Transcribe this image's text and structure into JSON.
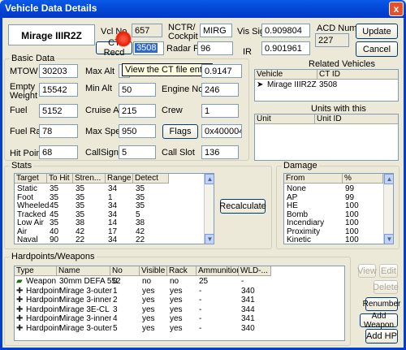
{
  "window": {
    "title": "Vehicle Data Details",
    "close_glyph": "x"
  },
  "name_box": "Mirage IIIR2Z",
  "vcl_no": {
    "label": "Vcl No",
    "value": "657"
  },
  "nctr": {
    "label_line1": "NCTR/",
    "label_line2": "Cockpit",
    "value": "MIRG"
  },
  "vis_sig": {
    "label": "Vis Sig",
    "value": "0.909804"
  },
  "acd_number": {
    "label": "ACD Number",
    "value": "227"
  },
  "ct_recd": {
    "label": "CT Recd",
    "value": "3508"
  },
  "radar_ptr": {
    "label": "Radar Ptr",
    "value": "96"
  },
  "ir": {
    "label": "IR",
    "value": "0.901961"
  },
  "buttons": {
    "update": "Update",
    "cancel": "Cancel",
    "recalculate": "Recalculate",
    "flags": "Flags",
    "view": "View",
    "edit": "Edit",
    "delete": "Delete",
    "renumber": "Renumber",
    "add_weapon": "Add Weapon",
    "add_hp": "Add HP"
  },
  "tooltip": "View the CT file entry",
  "basic": {
    "title": "Basic Data",
    "mtow": {
      "label": "MTOW",
      "value": "30203"
    },
    "max_alt": {
      "label": "Max Alt",
      "value": "2"
    },
    "max_alt_right": "0.9147",
    "empty_weight": {
      "label_line1": "Empty",
      "label_line2": "Weight",
      "value": "15542"
    },
    "min_alt": {
      "label": "Min Alt",
      "value": "50"
    },
    "engine_noise": {
      "label": "Engine Noise",
      "value": "246"
    },
    "fuel": {
      "label": "Fuel",
      "value": "5152"
    },
    "cruise_alt": {
      "label": "Cruise Alt",
      "value": "215"
    },
    "crew": {
      "label": "Crew",
      "value": "1"
    },
    "fuel_rate": {
      "label": "Fuel Rate",
      "value": "78"
    },
    "max_speed": {
      "label": "Max Speed",
      "value": "950"
    },
    "flags_value": "0x40000451",
    "hit_points": {
      "label": "Hit Points",
      "value": "68"
    },
    "callsign": {
      "label": "CallSign",
      "value": "5"
    },
    "call_slot": {
      "label": "Call Slot",
      "value": "136"
    }
  },
  "related": {
    "title": "Related Vehicles",
    "columns": [
      "Vehicle",
      "CT ID"
    ],
    "rows": [
      {
        "vehicle": "Mirage IIIR2Z",
        "ct_id": "3508"
      }
    ]
  },
  "units": {
    "title": "Units with this",
    "columns": [
      "Unit",
      "Unit ID"
    ]
  },
  "stats": {
    "title": "Stats",
    "columns": [
      "Target",
      "To Hit",
      "Stren...",
      "Range",
      "Detect"
    ],
    "rows": [
      [
        "Static",
        "35",
        "35",
        "34",
        "35"
      ],
      [
        "Foot",
        "35",
        "35",
        "1",
        "35"
      ],
      [
        "Wheeled",
        "45",
        "35",
        "34",
        "35"
      ],
      [
        "Tracked",
        "45",
        "35",
        "34",
        "5"
      ],
      [
        "Low Air",
        "35",
        "38",
        "14",
        "38"
      ],
      [
        "Air",
        "40",
        "42",
        "17",
        "42"
      ],
      [
        "Naval",
        "90",
        "22",
        "34",
        "22"
      ]
    ]
  },
  "damage": {
    "title": "Damage",
    "columns": [
      "From",
      "%"
    ],
    "rows": [
      [
        "None",
        "99"
      ],
      [
        "AP",
        "99"
      ],
      [
        "HE",
        "100"
      ],
      [
        "Bomb",
        "100"
      ],
      [
        "Incendiary",
        "100"
      ],
      [
        "Proximity",
        "100"
      ],
      [
        "Kinetic",
        "100"
      ]
    ]
  },
  "hardpoints": {
    "title": "Hardpoints/Weapons",
    "columns": [
      "Type",
      "Name",
      "No",
      "Visible",
      "Rack",
      "Ammunition",
      "WLD-..."
    ],
    "rows": [
      {
        "type": "Weapon",
        "name": "30mm DEFA 552",
        "no": "0",
        "visible": "no",
        "rack": "no",
        "ammo": "25",
        "wld": "-"
      },
      {
        "type": "Hardpoint",
        "name": "Mirage 3-outer",
        "no": "1",
        "visible": "yes",
        "rack": "yes",
        "ammo": "-",
        "wld": "340"
      },
      {
        "type": "Hardpoint",
        "name": "Mirage 3-inner",
        "no": "2",
        "visible": "yes",
        "rack": "yes",
        "ammo": "-",
        "wld": "341"
      },
      {
        "type": "Hardpoint",
        "name": "Mirage 3E-CL",
        "no": "3",
        "visible": "yes",
        "rack": "yes",
        "ammo": "-",
        "wld": "344"
      },
      {
        "type": "Hardpoint",
        "name": "Mirage 3-inner",
        "no": "4",
        "visible": "yes",
        "rack": "yes",
        "ammo": "-",
        "wld": "341"
      },
      {
        "type": "Hardpoint",
        "name": "Mirage 3-outer",
        "no": "5",
        "visible": "yes",
        "rack": "yes",
        "ammo": "-",
        "wld": "340"
      }
    ]
  },
  "colors": {
    "title_bar": "#0349d8",
    "selection": "#316ac5",
    "field_border": "#7f9db9",
    "dialog_bg": "#ece9d8"
  }
}
